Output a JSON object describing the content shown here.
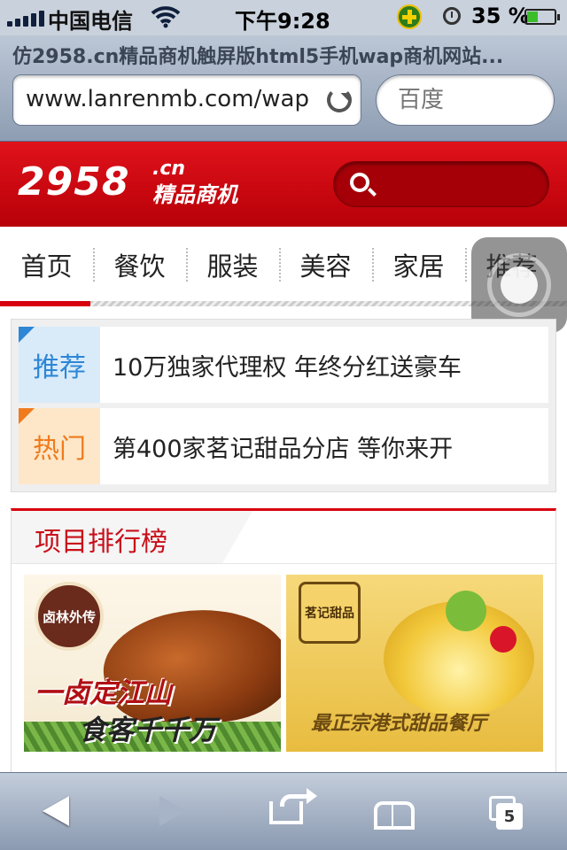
{
  "status": {
    "carrier": "中国电信",
    "time": "下午9:28",
    "battery": "35 %"
  },
  "browser": {
    "title": "仿2958.cn精品商机触屏版html5手机wap商机网站...",
    "url": "www.lanrenmb.com/wap",
    "search_placeholder": "百度",
    "tab_count": "5"
  },
  "site": {
    "logo_num": "2958",
    "logo_cn": ".cn",
    "logo_sub": "精品商机"
  },
  "nav": {
    "items": [
      "首页",
      "餐饮",
      "服装",
      "美容",
      "家居",
      "推荐"
    ]
  },
  "notices": [
    {
      "tag": "推荐",
      "text": "10万独家代理权 年终分红送豪车",
      "color": "#2d86d6"
    },
    {
      "tag": "热门",
      "text": "第400家茗记甜品分店 等你来开",
      "color": "#f07a1c"
    }
  ],
  "ranking": {
    "title": "项目排行榜",
    "banners": [
      {
        "badge": "卤林外传",
        "line1": "一卤定江山",
        "line2": "食客千千万"
      },
      {
        "badge": "茗记甜品",
        "line1": "最正宗港式甜品餐厅"
      }
    ]
  },
  "colors": {
    "brand_red": "#d8000e",
    "blue_tag": "#2d86d6",
    "orange_tag": "#f07a1c"
  }
}
